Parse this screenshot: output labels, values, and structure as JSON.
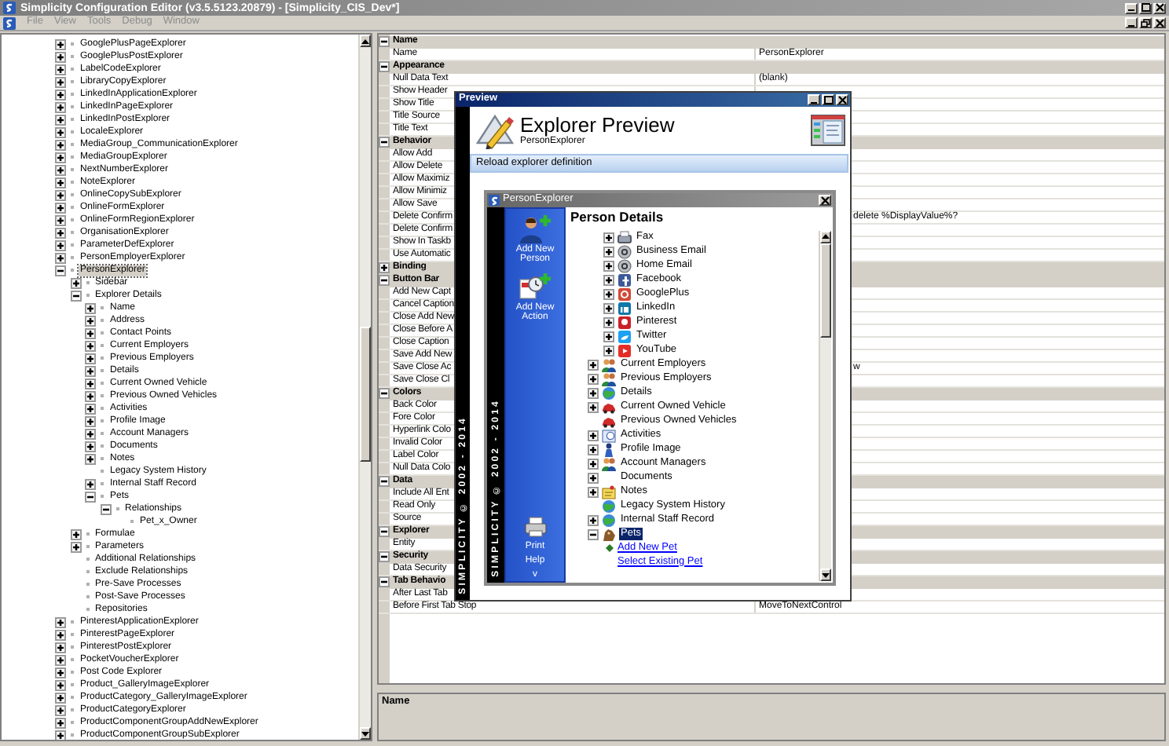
{
  "window": {
    "title": "Simplicity Configuration Editor (v3.5.5123.20879) - [Simplicity_CIS_Dev*]"
  },
  "menu": [
    "File",
    "View",
    "Tools",
    "Debug",
    "Window"
  ],
  "explorer_tree": [
    {
      "label": "GooglePlusPageExplorer",
      "kind": "branch",
      "expanded": false,
      "selected": false
    },
    {
      "label": "GooglePlusPostExplorer",
      "kind": "branch",
      "expanded": false,
      "selected": false
    },
    {
      "label": "LabelCodeExplorer",
      "kind": "branch",
      "expanded": false,
      "selected": false
    },
    {
      "label": "LibraryCopyExplorer",
      "kind": "branch",
      "expanded": false,
      "selected": false
    },
    {
      "label": "LinkedInApplicationExplorer",
      "kind": "branch",
      "expanded": false,
      "selected": false
    },
    {
      "label": "LinkedInPageExplorer",
      "kind": "branch",
      "expanded": false,
      "selected": false
    },
    {
      "label": "LinkedInPostExplorer",
      "kind": "branch",
      "expanded": false,
      "selected": false
    },
    {
      "label": "LocaleExplorer",
      "kind": "branch",
      "expanded": false,
      "selected": false
    },
    {
      "label": "MediaGroup_CommunicationExplorer",
      "kind": "branch",
      "expanded": false,
      "selected": false
    },
    {
      "label": "MediaGroupExplorer",
      "kind": "branch",
      "expanded": false,
      "selected": false
    },
    {
      "label": "NextNumberExplorer",
      "kind": "branch",
      "expanded": false,
      "selected": false
    },
    {
      "label": "NoteExplorer",
      "kind": "branch",
      "expanded": false,
      "selected": false
    },
    {
      "label": "OnlineCopySubExplorer",
      "kind": "branch",
      "expanded": false,
      "selected": false
    },
    {
      "label": "OnlineFormExplorer",
      "kind": "branch",
      "expanded": false,
      "selected": false
    },
    {
      "label": "OnlineFormRegionExplorer",
      "kind": "branch",
      "expanded": false,
      "selected": false
    },
    {
      "label": "OrganisationExplorer",
      "kind": "branch",
      "expanded": false,
      "selected": false
    },
    {
      "label": "ParameterDefExplorer",
      "kind": "branch",
      "expanded": false,
      "selected": false
    },
    {
      "label": "PersonEmployerExplorer",
      "kind": "branch",
      "expanded": false,
      "selected": false
    },
    {
      "label": "PersonExplorer",
      "kind": "branch",
      "expanded": true,
      "selected": true,
      "children": [
        {
          "label": "Sidebar",
          "kind": "branch",
          "expanded": false,
          "selected": false
        },
        {
          "label": "Explorer Details",
          "kind": "branch",
          "expanded": true,
          "selected": false,
          "children": [
            {
              "label": "Name",
              "kind": "branch",
              "expanded": false,
              "selected": false
            },
            {
              "label": "Address",
              "kind": "branch",
              "expanded": false,
              "selected": false
            },
            {
              "label": "Contact Points",
              "kind": "branch",
              "expanded": false,
              "selected": false
            },
            {
              "label": "Current Employers",
              "kind": "branch",
              "expanded": false,
              "selected": false
            },
            {
              "label": "Previous Employers",
              "kind": "branch",
              "expanded": false,
              "selected": false
            },
            {
              "label": "Details",
              "kind": "branch",
              "expanded": false,
              "selected": false
            },
            {
              "label": "Current Owned Vehicle",
              "kind": "branch",
              "expanded": false,
              "selected": false
            },
            {
              "label": "Previous Owned Vehicles",
              "kind": "branch",
              "expanded": false,
              "selected": false
            },
            {
              "label": "Activities",
              "kind": "branch",
              "expanded": false,
              "selected": false
            },
            {
              "label": "Profile Image",
              "kind": "branch",
              "expanded": false,
              "selected": false
            },
            {
              "label": "Account Managers",
              "kind": "branch",
              "expanded": false,
              "selected": false
            },
            {
              "label": "Documents",
              "kind": "branch",
              "expanded": false,
              "selected": false
            },
            {
              "label": "Notes",
              "kind": "branch",
              "expanded": false,
              "selected": false
            },
            {
              "label": "Legacy System History",
              "kind": "leaf",
              "selected": false
            },
            {
              "label": "Internal Staff Record",
              "kind": "branch",
              "expanded": false,
              "selected": false
            },
            {
              "label": "Pets",
              "kind": "branch",
              "expanded": true,
              "selected": false,
              "children": [
                {
                  "label": "Relationships",
                  "kind": "branch",
                  "expanded": true,
                  "selected": false,
                  "children": [
                    {
                      "label": "Pet_x_Owner",
                      "kind": "leaf",
                      "selected": false
                    }
                  ]
                }
              ]
            }
          ]
        },
        {
          "label": "Formulae",
          "kind": "branch",
          "expanded": false,
          "selected": false
        },
        {
          "label": "Parameters",
          "kind": "branch",
          "expanded": false,
          "selected": false
        },
        {
          "label": "Additional Relationships",
          "kind": "leaf",
          "selected": false
        },
        {
          "label": "Exclude Relationships",
          "kind": "leaf",
          "selected": false
        },
        {
          "label": "Pre-Save Processes",
          "kind": "leaf",
          "selected": false
        },
        {
          "label": "Post-Save Processes",
          "kind": "leaf",
          "selected": false
        },
        {
          "label": "Repositories",
          "kind": "leaf",
          "selected": false
        }
      ]
    },
    {
      "label": "PinterestApplicationExplorer",
      "kind": "branch",
      "expanded": false,
      "selected": false
    },
    {
      "label": "PinterestPageExplorer",
      "kind": "branch",
      "expanded": false,
      "selected": false
    },
    {
      "label": "PinterestPostExplorer",
      "kind": "branch",
      "expanded": false,
      "selected": false
    },
    {
      "label": "PocketVoucherExplorer",
      "kind": "branch",
      "expanded": false,
      "selected": false
    },
    {
      "label": "Post Code Explorer",
      "kind": "branch",
      "expanded": false,
      "selected": false
    },
    {
      "label": "Product_GalleryImageExplorer",
      "kind": "branch",
      "expanded": false,
      "selected": false
    },
    {
      "label": "ProductCategory_GalleryImageExplorer",
      "kind": "branch",
      "expanded": false,
      "selected": false
    },
    {
      "label": "ProductCategoryExplorer",
      "kind": "branch",
      "expanded": false,
      "selected": false
    },
    {
      "label": "ProductComponentGroupAddNewExplorer",
      "kind": "branch",
      "expanded": false,
      "selected": false
    },
    {
      "label": "ProductComponentGroupSubExplorer",
      "kind": "branch",
      "expanded": false,
      "selected": false
    }
  ],
  "property_grid": {
    "categories": [
      {
        "name": "Name",
        "expanded": true,
        "properties": [
          {
            "label": "Name",
            "value": "PersonExplorer"
          }
        ]
      },
      {
        "name": "Appearance",
        "expanded": true,
        "properties": [
          {
            "label": "Null Data Text",
            "value": "(blank)"
          },
          {
            "label": "Show Header"
          },
          {
            "label": "Show Title"
          },
          {
            "label": "Title Source"
          },
          {
            "label": "Title Text"
          }
        ]
      },
      {
        "name": "Behavior",
        "expanded": true,
        "properties": [
          {
            "label": "Allow Add"
          },
          {
            "label": "Allow Delete"
          },
          {
            "label": "Allow Maximiz"
          },
          {
            "label": "Allow Minimiz"
          },
          {
            "label": "Allow Save"
          },
          {
            "label": "Delete Confirm",
            "value": "delete %DisplayValue%?"
          },
          {
            "label": "Delete Confirm"
          },
          {
            "label": "Show In Taskb"
          },
          {
            "label": "Use Automatic"
          }
        ]
      },
      {
        "name": "Binding",
        "expanded": false
      },
      {
        "name": "Button Bar",
        "expanded": true,
        "properties": [
          {
            "label": "Add New Capt"
          },
          {
            "label": "Cancel Caption"
          },
          {
            "label": "Close Add New"
          },
          {
            "label": "Close Before A"
          },
          {
            "label": "Close Caption"
          },
          {
            "label": "Save Add New"
          },
          {
            "label": "Save Close Ac",
            "value": "w"
          },
          {
            "label": "Save Close Cl"
          }
        ]
      },
      {
        "name": "Colors",
        "expanded": true,
        "properties": [
          {
            "label": "Back Color"
          },
          {
            "label": "Fore Color"
          },
          {
            "label": "Hyperlink Colo"
          },
          {
            "label": "Invalid Color"
          },
          {
            "label": "Label Color"
          },
          {
            "label": "Null Data Colo"
          }
        ]
      },
      {
        "name": "Data",
        "expanded": true,
        "properties": [
          {
            "label": "Include All Ent"
          },
          {
            "label": "Read Only"
          },
          {
            "label": "Source"
          }
        ]
      },
      {
        "name": "Explorer",
        "expanded": true,
        "properties": [
          {
            "label": "Entity"
          }
        ]
      },
      {
        "name": "Security",
        "expanded": true,
        "properties": [
          {
            "label": "Data Security"
          }
        ]
      },
      {
        "name": "Tab Behavio",
        "expanded": true,
        "properties": [
          {
            "label": "After Last Tab"
          },
          {
            "label": "Before First Tab Stop",
            "value": "MoveToNextControl"
          }
        ]
      }
    ]
  },
  "description": {
    "title": "Name"
  },
  "preview": {
    "title": "Preview",
    "branding": "SIMPLICITY © 2002 - 2014",
    "heading": "Explorer Preview",
    "subheading": "PersonExplorer",
    "reload_bar": "Reload explorer definition",
    "explorer_window": {
      "title": "PersonExplorer",
      "branding": "SIMPLICITY © 2002 - 2014",
      "sidebar_actions": [
        {
          "label": "Add New Person"
        },
        {
          "label": "Add New Action"
        }
      ],
      "sidebar_footer": [
        "Print",
        "Help",
        "v"
      ],
      "heading": "Person Details",
      "tree": {
        "scrolled_children": [
          {
            "label": "Fax",
            "expanded": false
          },
          {
            "label": "Business Email",
            "expanded": false
          },
          {
            "label": "Home Email",
            "expanded": false
          },
          {
            "label": "Facebook",
            "expanded": false
          },
          {
            "label": "GooglePlus",
            "expanded": false
          },
          {
            "label": "LinkedIn",
            "expanded": false
          },
          {
            "label": "Pinterest",
            "expanded": false
          },
          {
            "label": "Twitter",
            "expanded": false
          },
          {
            "label": "YouTube",
            "expanded": false
          }
        ],
        "items": [
          {
            "label": "Current Employers",
            "kind": "branch",
            "expanded": false,
            "selected": false
          },
          {
            "label": "Previous Employers",
            "kind": "branch",
            "expanded": false,
            "selected": false
          },
          {
            "label": "Details",
            "kind": "branch",
            "expanded": false,
            "selected": false
          },
          {
            "label": "Current Owned Vehicle",
            "kind": "branch",
            "expanded": false,
            "selected": false
          },
          {
            "label": "Previous Owned Vehicles",
            "kind": "leaf",
            "selected": false
          },
          {
            "label": "Activities",
            "kind": "branch",
            "expanded": false,
            "selected": false
          },
          {
            "label": "Profile Image",
            "kind": "branch",
            "expanded": false,
            "selected": false
          },
          {
            "label": "Account Managers",
            "kind": "branch",
            "expanded": false,
            "selected": false
          },
          {
            "label": "Documents",
            "kind": "branch",
            "expanded": false,
            "selected": false
          },
          {
            "label": "Notes",
            "kind": "branch",
            "expanded": false,
            "selected": false
          },
          {
            "label": "Legacy System History",
            "kind": "leaf",
            "selected": false
          },
          {
            "label": "Internal Staff Record",
            "kind": "branch",
            "expanded": false,
            "selected": false
          },
          {
            "label": "Pets",
            "kind": "branch",
            "expanded": true,
            "selected": true,
            "children": [
              {
                "label": "Add New Pet",
                "kind": "add-link"
              },
              {
                "label": "Select Existing Pet",
                "kind": "link"
              }
            ]
          }
        ]
      }
    }
  }
}
